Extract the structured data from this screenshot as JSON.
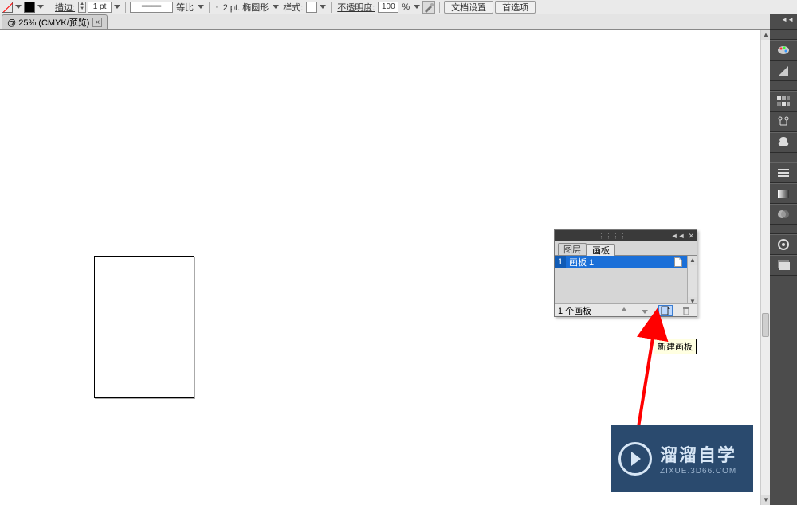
{
  "toolbar": {
    "stroke_label": "描边:",
    "stroke_width": "1 pt",
    "dash_label": "等比",
    "dash_value": "2 pt. 椭圆形",
    "style_label": "样式:",
    "opacity_label": "不透明度:",
    "opacity_value": "100",
    "opacity_unit": "%",
    "doc_setup_btn": "文档设置",
    "prefs_btn": "首选项"
  },
  "document": {
    "tab_title": "@ 25% (CMYK/预览)"
  },
  "panel": {
    "tab_layers": "图层",
    "tab_artboards": "画板",
    "row_index": "1",
    "row_name": "画板 1",
    "status_text": "1 个画板"
  },
  "tooltip": {
    "text": "新建画板"
  },
  "watermark": {
    "big": "溜溜自学",
    "small": "ZIXUE.3D66.COM"
  },
  "rightstrip": {
    "collapse": "◄◄"
  }
}
